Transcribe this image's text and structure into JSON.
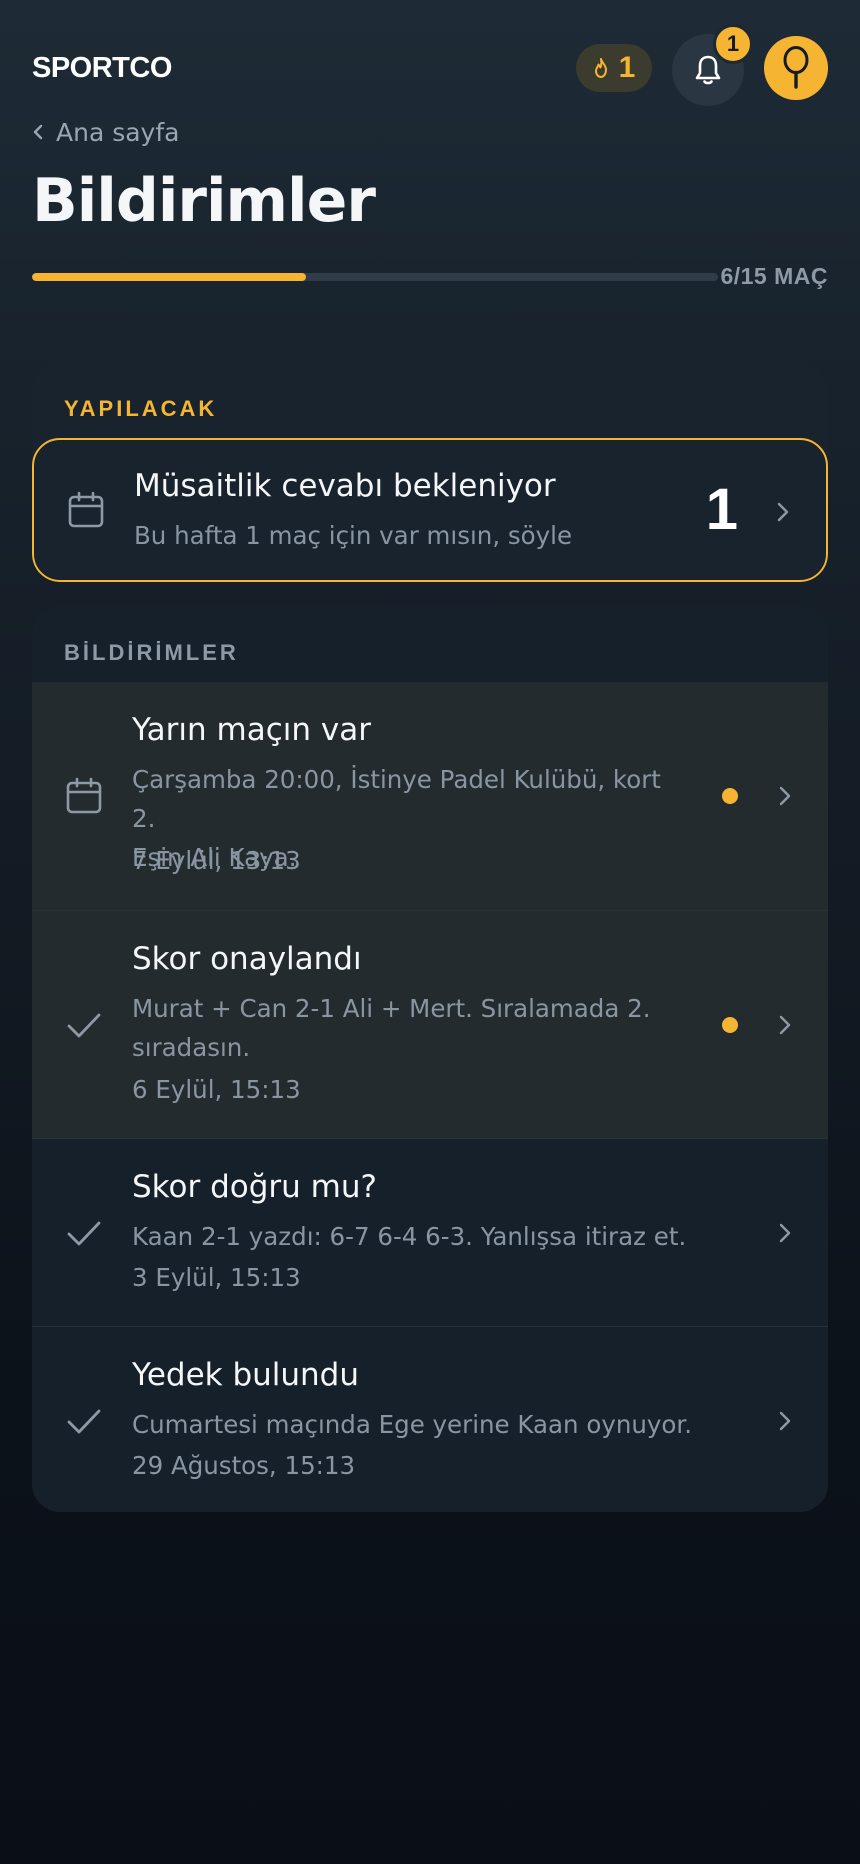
{
  "header": {
    "logo": "SPORTCO",
    "streak_count": "1",
    "notification_badge": "1",
    "back_label": "Ana sayfa",
    "title": "Bildirimler",
    "progress": {
      "label": "6/15 MAÇ",
      "fraction": 0.4
    }
  },
  "todo": {
    "section_label": "YAPILACAK",
    "item": {
      "icon": "calendar-icon",
      "title": "Müsaitlik cevabı bekleniyor",
      "subtitle": "Bu hafta 1 maç için var mısın, söyle",
      "count": "1"
    }
  },
  "notifications": {
    "section_label": "BİLDİRİMLER",
    "items": [
      {
        "icon": "calendar-icon",
        "title": "Yarın maçın var",
        "body_line1": "Çarşamba 20:00, İstinye Padel Kulübü, kort 2.",
        "body_line2": "Eşin Ali Kaya.",
        "time": "7 Eylül, 13:13",
        "unread": true
      },
      {
        "icon": "check-icon",
        "title": "Skor onaylandı",
        "body_line1": "Murat + Can 2-1 Ali + Mert. Sıralamada 2.",
        "body_line2": "sıradasın.",
        "time": "6 Eylül, 15:13",
        "unread": true
      },
      {
        "icon": "check-icon",
        "title": "Skor doğru mu?",
        "body_line1": "Kaan 2-1 yazdı: 6-7 6-4 6-3. Yanlışsa itiraz et.",
        "time": "3 Eylül, 15:13",
        "unread": false
      },
      {
        "icon": "check-icon",
        "title": "Yedek bulundu",
        "body_line1": "Cumartesi maçında Ege yerine Kaan oynuyor.",
        "time": "29 Ağustos, 15:13",
        "unread": false
      }
    ]
  },
  "colors": {
    "accent": "#f5b532",
    "background": "#0c121a",
    "card": "#16202a",
    "unread_row": "#232b2f",
    "muted_text": "#8996a2"
  }
}
